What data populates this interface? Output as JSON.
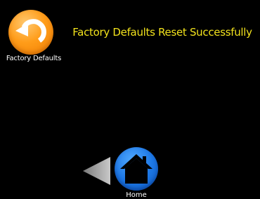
{
  "factory_defaults": {
    "label": "Factory Defaults",
    "icon": "reset-arrow-icon",
    "icon_color": "#f7901e"
  },
  "status": {
    "message": "Factory Defaults Reset Successfully",
    "color": "#f2e21c"
  },
  "navigation": {
    "back_icon": "back-triangle-icon",
    "home_label": "Home",
    "home_icon": "house-icon",
    "home_color": "#1d78e6"
  }
}
